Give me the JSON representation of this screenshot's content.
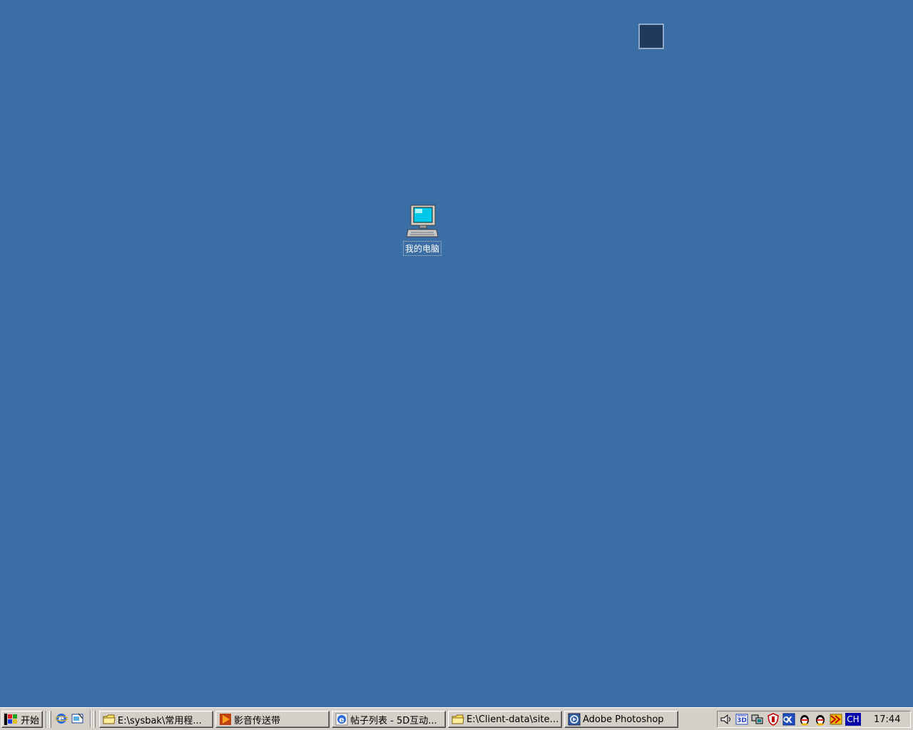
{
  "desktop": {
    "background": "#3b6ea5",
    "icons": [
      {
        "label": "我的电脑",
        "icon": "my-computer-icon"
      }
    ]
  },
  "taskbar": {
    "start_label": "开始",
    "quick_launch": [
      {
        "icon": "internet-explorer-icon"
      },
      {
        "icon": "show-desktop-icon"
      }
    ],
    "tasks": [
      {
        "label": "E:\\sysbak\\常用程...",
        "icon": "folder-icon"
      },
      {
        "label": "影音传送带",
        "icon": "media-player-icon"
      },
      {
        "label": "帖子列表 - 5D互动...",
        "icon": "internet-explorer-icon"
      },
      {
        "label": "E:\\Client-data\\site -...",
        "icon": "folder-icon"
      },
      {
        "label": "Adobe Photoshop",
        "icon": "photoshop-icon"
      }
    ],
    "tray": {
      "icons": [
        "volume-icon",
        "network-icon",
        "monitor-icon",
        "antivirus-shield-icon",
        "outlook-icon",
        "qq-penguin-icon",
        "qq-penguin-icon",
        "download-tool-icon"
      ],
      "ime_label": "CH",
      "clock": "17:44"
    }
  }
}
